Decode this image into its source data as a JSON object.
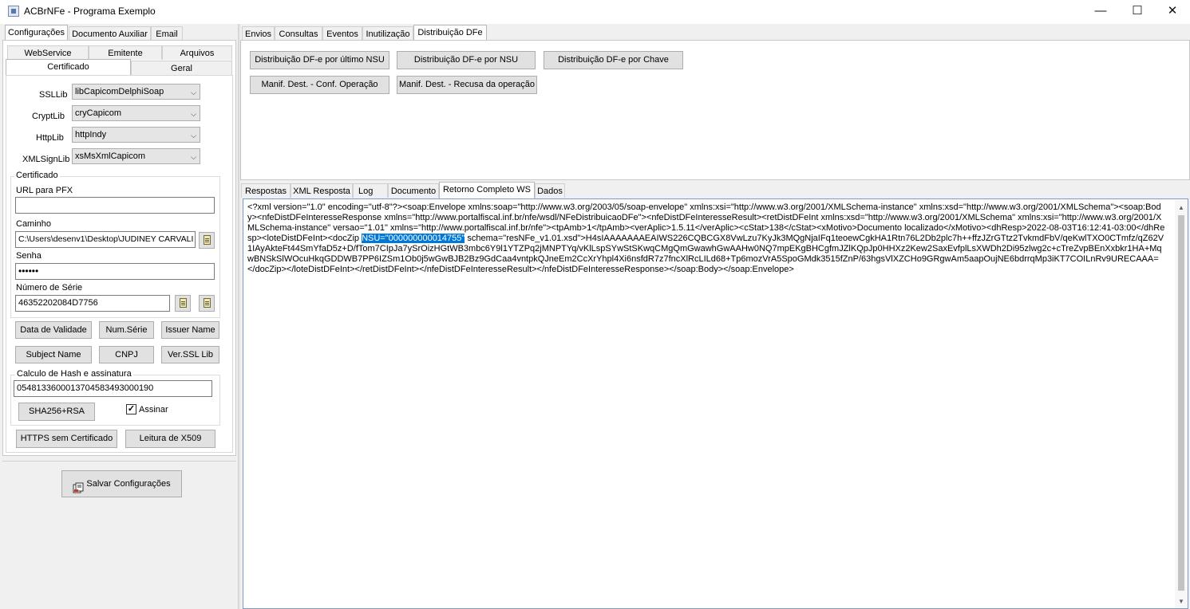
{
  "window": {
    "title": "ACBrNFe - Programa Exemplo",
    "minimize": "—",
    "maximize": "☐",
    "close": "✕"
  },
  "left": {
    "tabs": [
      "Configurações",
      "Documento Auxiliar",
      "Email"
    ],
    "subtabs_row1": [
      "WebService",
      "Emitente",
      "Arquivos"
    ],
    "subtabs_row2": [
      "Certificado",
      "Geral"
    ],
    "libs": [
      {
        "label": "SSLLib",
        "value": "libCapicomDelphiSoap"
      },
      {
        "label": "CryptLib",
        "value": "cryCapicom"
      },
      {
        "label": "HttpLib",
        "value": "httpIndy"
      },
      {
        "label": "XMLSignLib",
        "value": "xsMsXmlCapicom"
      }
    ],
    "certificado": {
      "group_title": "Certificado",
      "url_label": "URL para PFX",
      "url_value": "",
      "caminho_label": "Caminho",
      "caminho_value": "C:\\Users\\desenv1\\Desktop\\JUDINEY CARVALI",
      "senha_label": "Senha",
      "senha_value": "••••••",
      "serie_label": "Número de Série",
      "serie_value": "46352202084D7756"
    },
    "buttons_row1": [
      "Data de Validade",
      "Num.Série",
      "Issuer Name"
    ],
    "buttons_row2": [
      "Subject Name",
      "CNPJ",
      "Ver.SSL Lib"
    ],
    "hash": {
      "group_title": "Calculo de Hash e assinatura",
      "value": "05481336000137045834930001​90",
      "button": "SHA256+RSA",
      "checkbox_label": "Assinar",
      "checkbox_mark": "✓"
    },
    "https_button": "HTTPS sem Certificado",
    "x509_button": "Leitura de X509",
    "save_button": "Salvar Configurações"
  },
  "right": {
    "tabs": [
      "Envios",
      "Consultas",
      "Eventos",
      "Inutilização",
      "Distribuição DFe"
    ],
    "dfe_buttons_row1": [
      "Distribuição DF-e por último NSU",
      "Distribuição DF-e por NSU",
      "Distribuição DF-e por Chave"
    ],
    "dfe_buttons_row2": [
      "Manif. Dest. - Conf. Operação",
      "Manif. Dest. - Recusa da operação"
    ],
    "result_tabs": [
      "Respostas",
      "XML Resposta",
      "Log",
      "Documento",
      "Retorno Completo WS",
      "Dados"
    ],
    "xml_before": "<?xml version=\"1.0\" encoding=\"utf-8\"?><soap:Envelope xmlns:soap=\"http://www.w3.org/2003/05/soap-envelope\" xmlns:xsi=\"http://www.w3.org/2001/XMLSchema-instance\" xmlns:xsd=\"http://www.w3.org/2001/XMLSchema\"><soap:Body><nfeDistDFeInteresseResponse xmlns=\"http://www.portalfiscal.inf.br/nfe/wsdl/NFeDistribuicaoDFe\"><nfeDistDFeInteresseResult><retDistDFeInt xmlns:xsd=\"http://www.w3.org/2001/XMLSchema\" xmlns:xsi=\"http://www.w3.org/2001/XMLSchema-instance\" versao=\"1.01\" xmlns=\"http://www.portalfiscal.inf.br/nfe\"><tpAmb>1</tpAmb><verAplic>1.5.11</verAplic><cStat>138</cStat><xMotivo>Documento localizado</xMotivo><dhResp>2022-08-03T16:12:41-03:00</dhResp><loteDistDFeInt><docZip ",
    "xml_selected": "NSU=\"000000000014755\"",
    "xml_after": " schema=\"resNFe_v1.01.xsd\">H4sIAAAAAAAEAIWS226CQBCGX8VwLzu7KyJk3MQgNjaIFq1teoewCgkHA1Rtn76L2Db2plc7h++ffzJZrGTtz2TvkmdFbV/qeKwlTXO0CTmfz/qZ62V1IAyAkteFt44SmYfaD5z+D/fTom7CIpJa7ySrOizHGtWB3mbc6Y9l1YTZPq2jMNPTYq/vKlLspSYwStSKwqCMgQmGwawhGwAAHw0NQ7mpEKgBHCgfmJZlKQpJp0HHXz2Kew2SaxEvfplLsXWDh2Di95zlwg2c+cTreZvpBEnXxbkr1HA+MqwBNSkSlWOcuHkqGDDWB7PP6IZSm1Ob0j5wGwBJB2Bz9GdCaa4vntpkQJneEm2CcXrYhpl4Xi6nsfdR7z7fncXlRcLILd68+Tp6mozVrA5SpoGMdk3515fZnP/63hgsVlXZCHo9GRgwAm5aapOujNE6bdrrqMp3iKT7COILnRv9URECAAA=</docZip></loteDistDFeInt></retDistDFeInt></nfeDistDFeInteresseResult></nfeDistDFeInteresseResponse></soap:Body></soap:Envelope>"
  }
}
